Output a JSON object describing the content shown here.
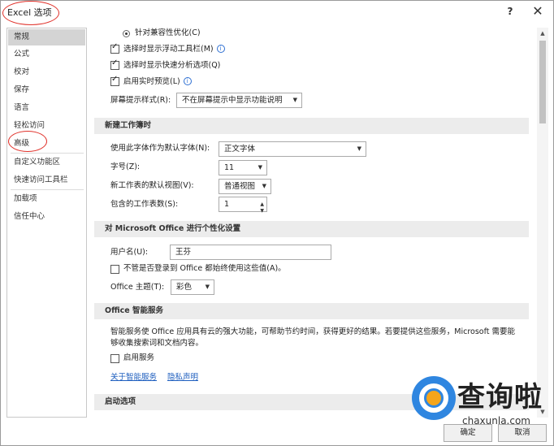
{
  "window": {
    "title": "Excel 选项",
    "help": "?",
    "close": "✕"
  },
  "sidebar": {
    "items": [
      {
        "label": "常规"
      },
      {
        "label": "公式"
      },
      {
        "label": "校对"
      },
      {
        "label": "保存"
      },
      {
        "label": "语言"
      },
      {
        "label": "轻松访问"
      },
      {
        "label": "高级"
      },
      {
        "label": "自定义功能区"
      },
      {
        "label": "快速访问工具栏"
      },
      {
        "label": "加载项"
      },
      {
        "label": "信任中心"
      }
    ]
  },
  "ui_options": {
    "compat_label": "针对兼容性优化(C)",
    "mini_toolbar_label": "选择时显示浮动工具栏(M)",
    "quick_analysis_label": "选择时显示快速分析选项(Q)",
    "live_preview_label": "启用实时预览(L)",
    "screentip_label": "屏幕提示样式(R):",
    "screentip_value": "不在屏幕提示中显示功能说明"
  },
  "new_workbook": {
    "header": "新建工作簿时",
    "font_label": "使用此字体作为默认字体(N):",
    "font_value": "正文字体",
    "size_label": "字号(Z):",
    "size_value": "11",
    "view_label": "新工作表的默认视图(V):",
    "view_value": "普通视图",
    "sheets_label": "包含的工作表数(S):",
    "sheets_value": "1"
  },
  "personalize": {
    "header": "对 Microsoft Office 进行个性化设置",
    "username_label": "用户名(U):",
    "username_value": "王芬",
    "always_use_label": "不管是否登录到 Office 都始终使用这些值(A)。",
    "theme_label": "Office 主题(T):",
    "theme_value": "彩色"
  },
  "intelligent": {
    "header": "Office 智能服务",
    "desc_line1": "智能服务使 Office 应用具有云的强大功能，可帮助节约时间，获得更好的结果。若要提供这些服务，Microsoft 需要能",
    "desc_line2": "够收集搜索词和文档内容。",
    "enable_label": "启用服务",
    "about_link": "关于智能服务",
    "privacy_link": "隐私声明"
  },
  "startup": {
    "header": "启动选项"
  },
  "footer": {
    "ok": "确定",
    "cancel": "取消"
  },
  "watermark": {
    "text": "查询啦",
    "url": "chaxunla.com"
  }
}
